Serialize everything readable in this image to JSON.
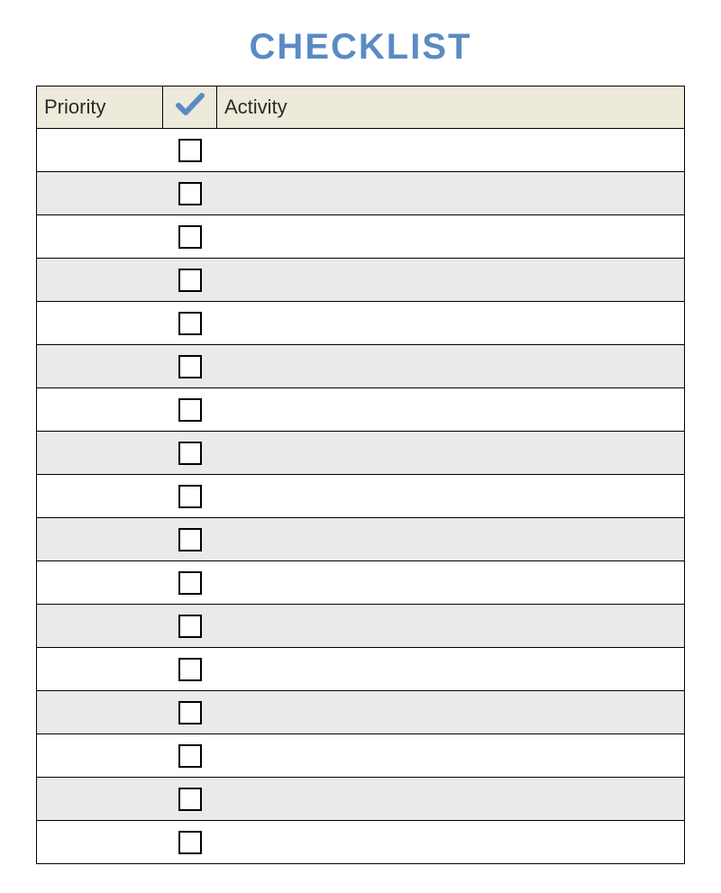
{
  "title": "CHECKLIST",
  "headers": {
    "priority": "Priority",
    "activity": "Activity"
  },
  "rows": [
    {
      "priority": "",
      "checked": false,
      "activity": ""
    },
    {
      "priority": "",
      "checked": false,
      "activity": ""
    },
    {
      "priority": "",
      "checked": false,
      "activity": ""
    },
    {
      "priority": "",
      "checked": false,
      "activity": ""
    },
    {
      "priority": "",
      "checked": false,
      "activity": ""
    },
    {
      "priority": "",
      "checked": false,
      "activity": ""
    },
    {
      "priority": "",
      "checked": false,
      "activity": ""
    },
    {
      "priority": "",
      "checked": false,
      "activity": ""
    },
    {
      "priority": "",
      "checked": false,
      "activity": ""
    },
    {
      "priority": "",
      "checked": false,
      "activity": ""
    },
    {
      "priority": "",
      "checked": false,
      "activity": ""
    },
    {
      "priority": "",
      "checked": false,
      "activity": ""
    },
    {
      "priority": "",
      "checked": false,
      "activity": ""
    },
    {
      "priority": "",
      "checked": false,
      "activity": ""
    },
    {
      "priority": "",
      "checked": false,
      "activity": ""
    },
    {
      "priority": "",
      "checked": false,
      "activity": ""
    },
    {
      "priority": "",
      "checked": false,
      "activity": ""
    }
  ]
}
